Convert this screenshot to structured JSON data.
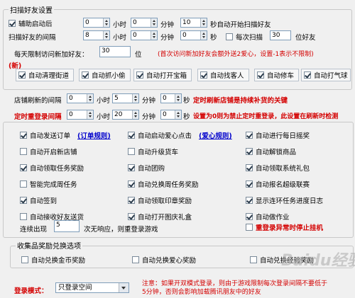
{
  "scan": {
    "legend": "扫描好友设置",
    "row1": {
      "checkbox_label": "辅助启动后",
      "hours": "0",
      "hours_unit": "小时",
      "minutes": "0",
      "minutes_unit": "分钟",
      "seconds": "10",
      "suffix": "秒自动开始扫描好友"
    },
    "row2": {
      "label": "扫描好友的间隔",
      "hours": "8",
      "hours_unit": "小时",
      "minutes": "0",
      "minutes_unit": "分钟",
      "seconds": "0",
      "seconds_unit": "秒",
      "checkbox_label": "每次扫描",
      "count": "30",
      "count_suffix": "位好友"
    },
    "row3": {
      "label": "每天限制访问新加好友：",
      "value": "30",
      "unit": "位",
      "note": "(首次访问新加好友会额外送2爱心，设置-1表示不限制)"
    },
    "new_tag": "(新)",
    "features": [
      "自动清理街道",
      "自动抓小偷",
      "自动打开宝箱",
      "自动找客人",
      "自动修车",
      "自动打气球"
    ]
  },
  "shop_refresh": {
    "label": "店铺刷新的间隔",
    "hours": "0",
    "hours_unit": "小时",
    "minutes": "5",
    "minutes_unit": "分钟",
    "seconds": "0",
    "seconds_unit": "秒",
    "note": "定时刷新店铺是持续补货的关键"
  },
  "relogin": {
    "label": "定时重登录间隔",
    "hours": "0",
    "hours_unit": "小时",
    "minutes": "20",
    "minutes_unit": "分钟",
    "seconds": "0",
    "seconds_unit": "秒",
    "note": "设置为0则为禁止定时重登录，此设置在刷新时检测"
  },
  "options": {
    "col1": [
      {
        "label": "自动发送订单",
        "checked": true,
        "link": "(订单规则)"
      },
      {
        "label": "自动开启新店铺",
        "checked": false
      },
      {
        "label": "自动领取任务奖励",
        "checked": true
      },
      {
        "label": "智能完成周任务",
        "checked": false
      },
      {
        "label": "自动签到",
        "checked": true
      },
      {
        "label": "自动接收好友送货",
        "checked": false
      }
    ],
    "col2": [
      {
        "label": "自动启动爱心点击",
        "checked": true,
        "link": "(爱心规则)"
      },
      {
        "label": "自动升级货车",
        "checked": false
      },
      {
        "label": "自动团购",
        "checked": true
      },
      {
        "label": "自动兑换周任务奖励",
        "checked": true
      },
      {
        "label": "自动领取印章奖励",
        "checked": true
      },
      {
        "label": "自动打开图庆礼盒",
        "checked": true
      }
    ],
    "col3": [
      {
        "label": "自动进行每日摇奖",
        "checked": true
      },
      {
        "label": "自动解锁商品",
        "checked": true
      },
      {
        "label": "自动领取系统礼包",
        "checked": true
      },
      {
        "label": "自动报名超级联赛",
        "checked": true
      },
      {
        "label": "显示连环任务进度日志",
        "checked": true
      },
      {
        "label": "自动做作业",
        "checked": true
      }
    ],
    "timeout": {
      "prefix": "连续出现",
      "value": "5",
      "suffix": "次无响应，则重登录游戏"
    },
    "stop_on_error": {
      "label": "重登录异常时停止挂机",
      "checked": false
    }
  },
  "rewards": {
    "legend": "收集品奖励兑换选项",
    "items": [
      {
        "label": "自动兑换金币奖励",
        "checked": false
      },
      {
        "label": "自动兑换爱心奖励",
        "checked": false
      },
      {
        "label": "自动兑换经验奖励",
        "checked": false
      }
    ]
  },
  "login": {
    "label": "登录模式：",
    "selected": "只登录空间",
    "note_line1": "注意：如果开双模式登录，则由于游戏限制每次登录间隔不要低于",
    "note_line2": "5分钟，否则会影响加载腾讯朋友中的好友"
  },
  "watermark": "Baidu经验"
}
